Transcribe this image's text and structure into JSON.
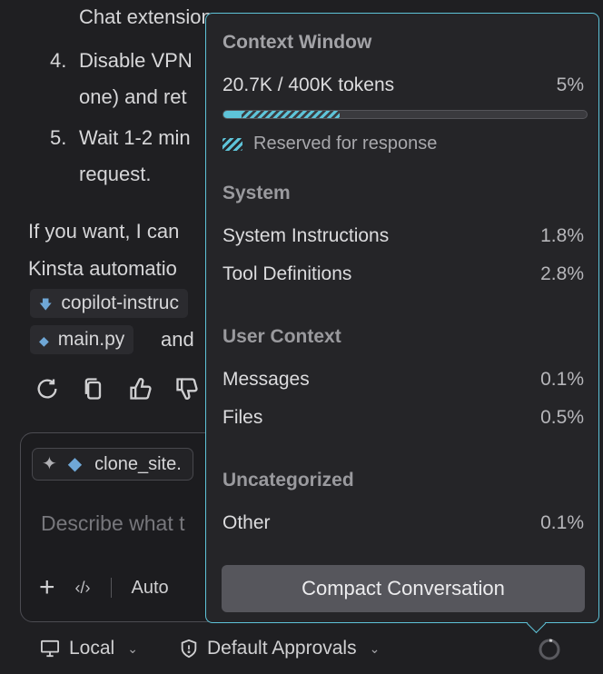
{
  "chat": {
    "item3_tail": "Chat extensions",
    "item4_num": "4.",
    "item4_line1": "Disable VPN",
    "item4_line2": "one) and ret",
    "item5_num": "5.",
    "item5_line1": "Wait 1-2 min",
    "item5_line2": "request.",
    "para_line1": "If you want, I can",
    "para_line2": "Kinsta automatio",
    "chip1": "copilot-instruc",
    "chip2": "main.py",
    "chip2_after": "and"
  },
  "input": {
    "file_chip": "clone_site.",
    "placeholder": "Describe what t",
    "auto_label": "Auto"
  },
  "statusbar": {
    "local_label": "Local",
    "approvals_label": "Default Approvals"
  },
  "context_window": {
    "title": "Context Window",
    "tokens_label": "20.7K / 400K tokens",
    "tokens_percent": "5%",
    "usage_used": 0.05,
    "usage_reserved": 0.32,
    "reserved_label": "Reserved for response",
    "colors": {
      "accent": "#5ec3d8"
    },
    "sections": {
      "system": {
        "title": "System",
        "rows": [
          {
            "label": "System Instructions",
            "value": "1.8%"
          },
          {
            "label": "Tool Definitions",
            "value": "2.8%"
          }
        ]
      },
      "user_context": {
        "title": "User Context",
        "rows": [
          {
            "label": "Messages",
            "value": "0.1%"
          },
          {
            "label": "Files",
            "value": "0.5%"
          }
        ]
      },
      "uncategorized": {
        "title": "Uncategorized",
        "rows": [
          {
            "label": "Other",
            "value": "0.1%"
          }
        ]
      }
    },
    "compact_button": "Compact Conversation"
  }
}
